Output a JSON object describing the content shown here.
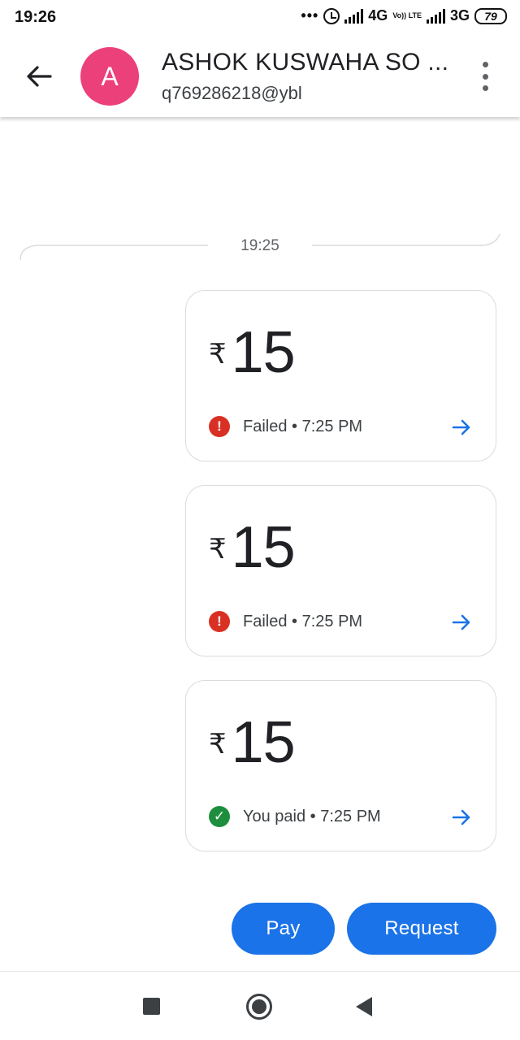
{
  "status_bar": {
    "time": "19:26",
    "dots": "•••",
    "network_1": "4G",
    "volte": "Vo)) LTE",
    "network_2": "3G",
    "battery": "79"
  },
  "header": {
    "avatar_letter": "A",
    "contact_name": "ASHOK KUSWAHA SO ...",
    "upi_id": "q769286218@ybl",
    "back_icon": "arrow-back-icon",
    "menu_icon": "more-vert-icon"
  },
  "divider": {
    "time": "19:25"
  },
  "payments": [
    {
      "currency": "₹",
      "amount": "15",
      "status_icon": "!",
      "status": "Failed • 7:25 PM",
      "state": "failed"
    },
    {
      "currency": "₹",
      "amount": "15",
      "status_icon": "!",
      "status": "Failed • 7:25 PM",
      "state": "failed"
    },
    {
      "currency": "₹",
      "amount": "15",
      "status_icon": "✓",
      "status": "You paid • 7:25 PM",
      "state": "paid"
    }
  ],
  "actions": {
    "pay": "Pay",
    "request": "Request"
  },
  "colors": {
    "accent": "#1a73e8",
    "avatar": "#ec407a",
    "failed": "#d93025",
    "paid": "#1e8e3e"
  }
}
